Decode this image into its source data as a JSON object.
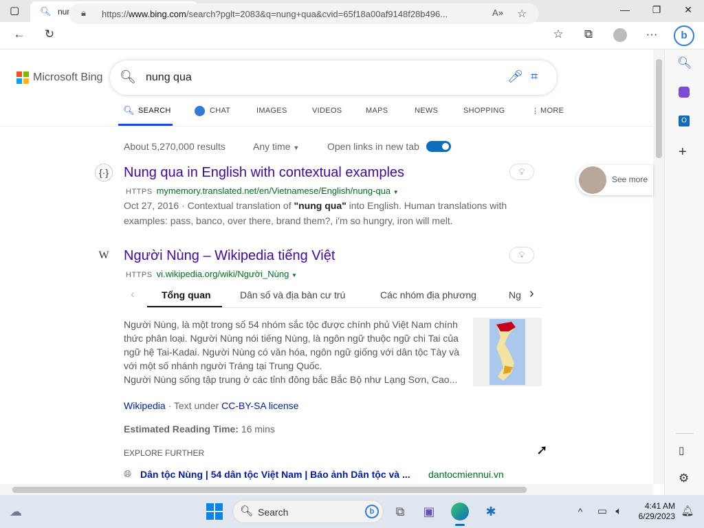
{
  "browser": {
    "tab_title": "nung qua - Search",
    "address": {
      "prefix": "https://",
      "domain": "www.bing.com",
      "rest": "/search?pglt=2083&q=nung+qua&cvid=65f18a00af9148f28b496..."
    },
    "window_controls": {
      "minimize": "—",
      "restore": "❐",
      "close": "✕"
    }
  },
  "bing": {
    "logo_text": "Microsoft Bing",
    "query": "nung qua",
    "scopes": [
      "SEARCH",
      "CHAT",
      "IMAGES",
      "VIDEOS",
      "MAPS",
      "NEWS",
      "SHOPPING",
      "MORE"
    ],
    "result_count": "About 5,270,000 results",
    "time_filter": "Any time",
    "open_new_tab_label": "Open links in new tab",
    "open_new_tab_on": true
  },
  "results": [
    {
      "title": "Nung qua in English with contextual examples",
      "https": "HTTPS",
      "url": "mymemory.translated.net/en/Vietnamese/English/nung-qua",
      "date": "Oct 27, 2016",
      "snippet_pre": " · Contextual translation of ",
      "snippet_bold": "\"nung qua\"",
      "snippet_post": " into English. Human translations with",
      "snippet_line2": "examples: pass, banco, over there, brand them?, i'm so hungry, iron will melt."
    },
    {
      "title": "Người Nùng – Wikipedia tiếng Việt",
      "https": "HTTPS",
      "url": "vi.wikipedia.org/wiki/Người_Nùng",
      "subtabs": [
        "Tổng quan",
        "Dân số và địa bàn cư trú",
        "Các nhóm địa phương",
        "Ng"
      ],
      "body_lines": [
        "Người Nùng, là một trong số 54 nhóm sắc tộc được chính phủ Việt Nam chính",
        "thức phân loại. Người Nùng nói tiếng Nùng, là ngôn ngữ thuộc ngữ chi Tai của",
        "ngữ hệ Tai-Kadai. Người Nùng có văn hóa, ngôn ngữ giống với dân tộc Tày và",
        "với một số nhánh người Tráng tại Trung Quốc.",
        "Người Nùng sống tập trung ở các tỉnh đông bắc Bắc Bộ như Lạng Sơn, Cao..."
      ],
      "source_link": "Wikipedia",
      "license_pre": " · Text under ",
      "license_link": "CC-BY-SA license",
      "reading_label": "Estimated Reading Time:",
      "reading_value": " 16 mins",
      "explore_label": "EXPLORE FURTHER",
      "explore_item": "Dân tộc Nùng | 54 dân tộc Việt Nam | Báo ảnh Dân tộc và ...",
      "explore_site": "dantocmiennui.vn"
    }
  ],
  "see_more": "See more",
  "taskbar": {
    "search_label": "Search",
    "time": "4:41 AM",
    "date": "6/29/2023"
  }
}
